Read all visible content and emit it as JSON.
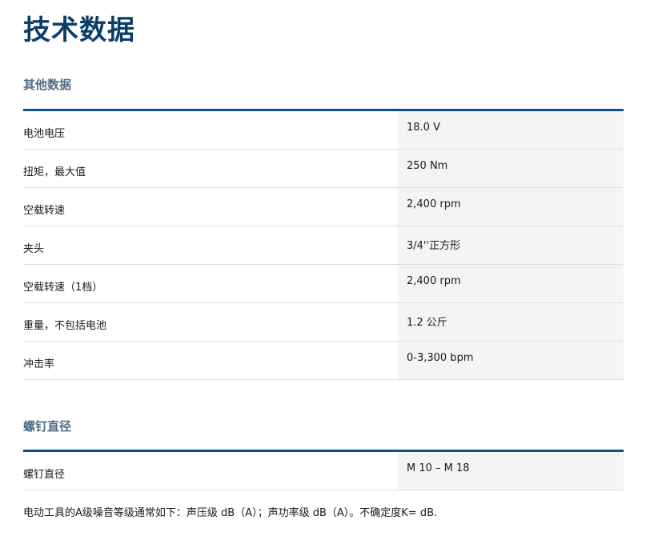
{
  "page_title": "技术数据",
  "sections": [
    {
      "title": "其他数据",
      "rows": [
        {
          "label": "电池电压",
          "value": "18.0 V"
        },
        {
          "label": "扭矩，最大值",
          "value": "250 Nm"
        },
        {
          "label": "空载转速",
          "value": "2,400 rpm"
        },
        {
          "label": "夹头",
          "value": "3/4''正方形"
        },
        {
          "label": "空载转速（1档）",
          "value": "2,400 rpm"
        },
        {
          "label": "重量，不包括电池",
          "value": "1.2 公斤"
        },
        {
          "label": "冲击率",
          "value": "0-3,300 bpm"
        }
      ]
    },
    {
      "title": "螺钉直径",
      "rows": [
        {
          "label": "螺钉直径",
          "value": "M 10 – M 18"
        }
      ]
    }
  ],
  "footnote": "电动工具的A级噪音等级通常如下：声压级 dB（A）；声功率级 dB（A）。不确定度K= dB.",
  "colors": {
    "title": "#0e3d6b",
    "section_title": "#4f6c87",
    "rule": "#0e4f86",
    "value_bg": "#f3f4f4",
    "row_border": "#dddddd"
  }
}
